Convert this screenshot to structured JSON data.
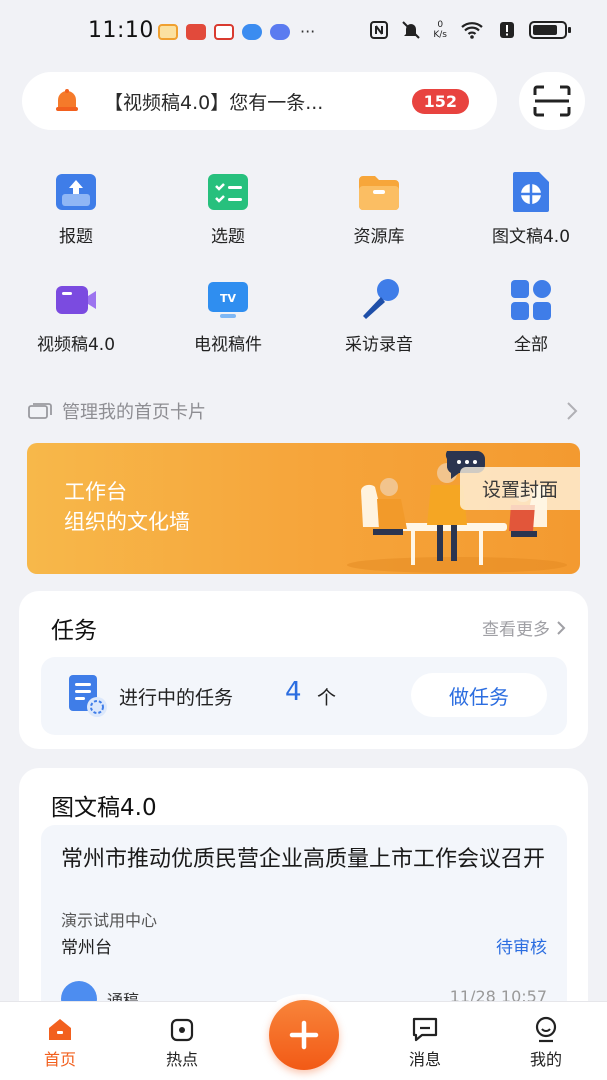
{
  "status_bar": {
    "time": "11:10",
    "net_speed_value": "0",
    "net_speed_unit": "K/s"
  },
  "notification": {
    "text": "【视频稿4.0】您有一条...",
    "badge": "152"
  },
  "grid": [
    {
      "label": "报题",
      "icon": "upload-doc-icon"
    },
    {
      "label": "选题",
      "icon": "checklist-icon"
    },
    {
      "label": "资源库",
      "icon": "folder-icon"
    },
    {
      "label": "图文稿4.0",
      "icon": "image-text-icon"
    },
    {
      "label": "视频稿4.0",
      "icon": "video-camera-icon"
    },
    {
      "label": "电视稿件",
      "icon": "tv-icon"
    },
    {
      "label": "采访录音",
      "icon": "microphone-icon"
    },
    {
      "label": "全部",
      "icon": "apps-grid-icon"
    }
  ],
  "manage_cards_label": "管理我的首页卡片",
  "banner": {
    "line1": "工作台",
    "line2": "组织的文化墙",
    "button": "设置封面"
  },
  "task_card": {
    "title": "任务",
    "more": "查看更多",
    "in_progress_label": "进行中的任务",
    "count": "4",
    "unit": "个",
    "action": "做任务"
  },
  "doc_card": {
    "title": "图文稿4.0",
    "item": {
      "headline": "常州市推动优质民营企业高质量上市工作会议召开",
      "org": "演示试用中心",
      "station": "常州台",
      "status": "待审核",
      "type": "通稿",
      "time": "11/28 10:57"
    }
  },
  "tabbar": [
    {
      "label": "首页",
      "active": true
    },
    {
      "label": "热点",
      "active": false
    },
    {
      "label": "消息",
      "active": false
    },
    {
      "label": "我的",
      "active": false
    }
  ],
  "colors": {
    "accent": "#f2601e",
    "link_blue": "#2b6de0",
    "badge_red": "#e8433f",
    "banner_orange": "#f6a53b"
  }
}
